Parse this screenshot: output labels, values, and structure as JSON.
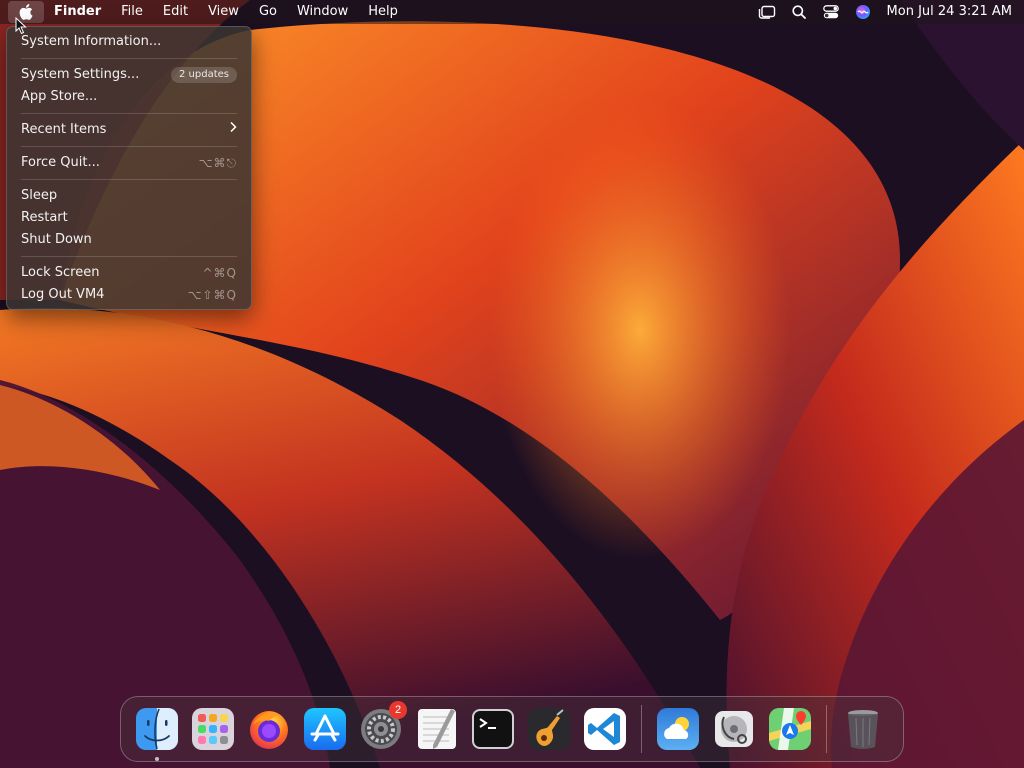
{
  "menubar": {
    "app_name": "Finder",
    "menus": [
      "File",
      "Edit",
      "View",
      "Go",
      "Window",
      "Help"
    ],
    "clock": "Mon Jul 24  3:21 AM",
    "status_icons": [
      "stage-manager-icon",
      "spotlight-search-icon",
      "control-center-icon",
      "siri-icon"
    ]
  },
  "apple_menu": {
    "items": {
      "system_information": "System Information...",
      "system_settings": "System Settings...",
      "system_settings_badge": "2 updates",
      "app_store": "App Store...",
      "recent_items": "Recent Items",
      "force_quit": "Force Quit...",
      "force_quit_shortcut": "⌥⌘⎋",
      "sleep": "Sleep",
      "restart": "Restart",
      "shut_down": "Shut Down",
      "lock_screen": "Lock Screen",
      "lock_screen_shortcut": "^⌘Q",
      "log_out": "Log Out VM4",
      "log_out_shortcut": "⌥⇧⌘Q"
    }
  },
  "dock": {
    "apps": [
      "finder-icon",
      "launchpad-icon",
      "firefox-icon",
      "app-store-icon",
      "system-settings-icon",
      "textedit-icon",
      "terminal-icon",
      "garageband-icon",
      "vscode-icon"
    ],
    "system_settings_badge": "2",
    "recent_apps": [
      "weather-icon",
      "disk-utility-icon",
      "maps-icon"
    ],
    "trash": "trash-icon"
  },
  "colors": {
    "menu_bg": "#3a3432",
    "badge_red": "#e8382e",
    "wallpaper_orange": "#e8401a"
  }
}
